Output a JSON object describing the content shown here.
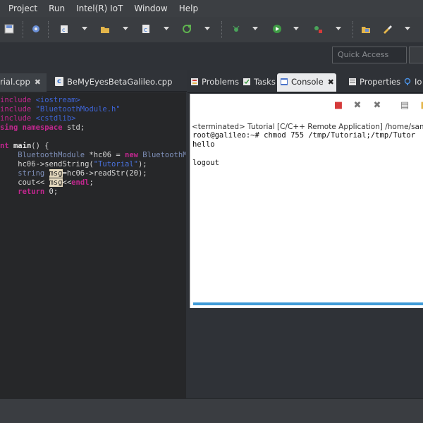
{
  "menu": [
    "Project",
    "Run",
    "Intel(R) IoT",
    "Window",
    "Help"
  ],
  "quick_access": {
    "placeholder": "Quick Access"
  },
  "editor_tabs": [
    {
      "label": "rial.cpp"
    },
    {
      "label": "BeMyEyesBetaGalileo.cpp"
    }
  ],
  "code": {
    "l1": [
      "include",
      " <iostream>"
    ],
    "l2": [
      "include",
      " \"BluetoothModule.h\""
    ],
    "l3": [
      "include",
      " <cstdlib>"
    ],
    "l4": [
      "sing",
      " namespace",
      " std;"
    ],
    "l6": [
      "nt",
      " main",
      "() {"
    ],
    "l7": [
      "    BluetoothModule",
      " *hc06 = ",
      "new",
      " BluetoothMod"
    ],
    "l8": [
      "    hc06->sendString(",
      "\"Tutorial\"",
      ");"
    ],
    "l9": [
      "    string",
      " ",
      "msg",
      "=hc06->readStr(20);"
    ],
    "l10": [
      "    cout<< ",
      "msg",
      "<<",
      "endl",
      ";"
    ],
    "l11": [
      "    return",
      " 0;"
    ]
  },
  "panel_tabs": [
    {
      "label": "Problems"
    },
    {
      "label": "Tasks"
    },
    {
      "label": "Console"
    },
    {
      "label": "Properties"
    },
    {
      "label": "Io"
    }
  ],
  "console": {
    "status": "<terminated> Tutorial [C/C++ Remote Application] /home/samuel/",
    "lines": [
      "root@galileo:~# chmod 755 /tmp/Tutorial;/tmp/Tutor",
      "hello",
      "",
      "logout"
    ]
  },
  "colors": {
    "keyword": "#c2278f",
    "include_path": "#3e64d6",
    "string": "#4a73e0",
    "console_accent": "#3f9bd8"
  }
}
